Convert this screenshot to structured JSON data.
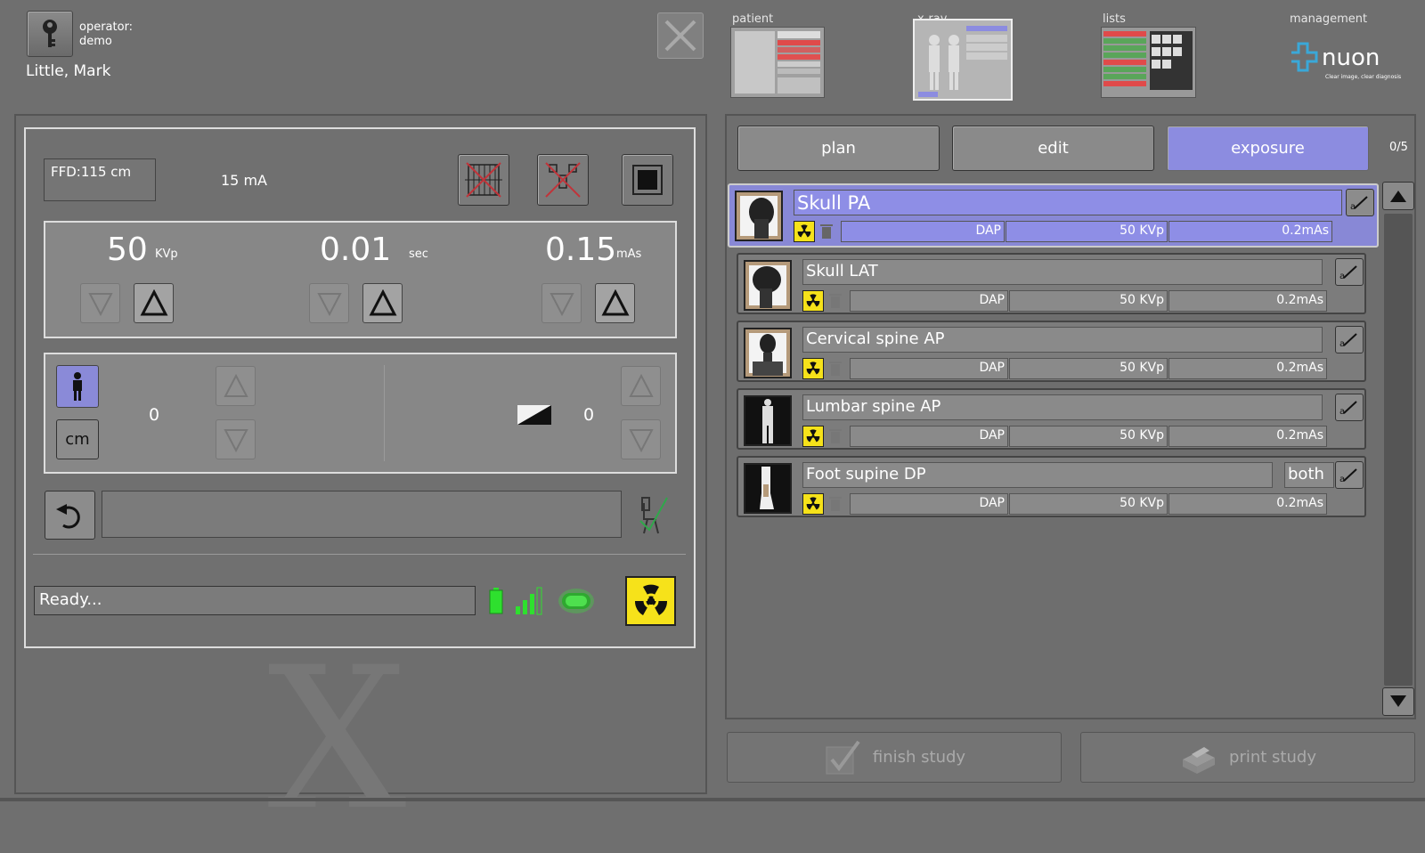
{
  "header": {
    "operator_label": "operator:",
    "operator_name": "demo",
    "patient_name": "Little,  Mark"
  },
  "nav": {
    "tabs": [
      {
        "label": "patient"
      },
      {
        "label": "x-ray"
      },
      {
        "label": "lists"
      },
      {
        "label": "management"
      }
    ],
    "active": "x-ray"
  },
  "brand": {
    "name": "nuon",
    "tagline": "Clear image, clear diagnosis",
    "color": "#3aa8d8"
  },
  "exposure_controls": {
    "ffd": "FFD:115 cm",
    "ma": "15 mA",
    "kvp": {
      "value": "50",
      "unit": "KVp"
    },
    "time": {
      "value": "0.01",
      "unit": "sec"
    },
    "mas": {
      "value": "0.15",
      "unit": "mAs"
    }
  },
  "patient_params": {
    "thickness_value": "0",
    "unit_button": "cm",
    "density_value": "0"
  },
  "status": {
    "text": "Ready..."
  },
  "workflow": {
    "buttons": [
      {
        "label": "plan"
      },
      {
        "label": "edit"
      },
      {
        "label": "exposure"
      }
    ],
    "active": "exposure",
    "counter": "0/5"
  },
  "exams": [
    {
      "title": "Skull PA",
      "dap": "DAP",
      "kvp": "50 KVp",
      "mas": "0.2mAs",
      "selected": true
    },
    {
      "title": "Skull LAT",
      "dap": "DAP",
      "kvp": "50 KVp",
      "mas": "0.2mAs"
    },
    {
      "title": "Cervical spine AP",
      "dap": "DAP",
      "kvp": "50 KVp",
      "mas": "0.2mAs"
    },
    {
      "title": "Lumbar spine AP",
      "dap": "DAP",
      "kvp": "50 KVp",
      "mas": "0.2mAs"
    },
    {
      "title": "Foot supine DP",
      "extra": "both",
      "dap": "DAP",
      "kvp": "50 KVp",
      "mas": "0.2mAs"
    }
  ],
  "footer": {
    "finish_label": "finish study",
    "print_label": "print study"
  },
  "colors": {
    "accent": "#8c8ce0",
    "radiation": "#f6e21a",
    "ready_led": "#3ddc3d"
  }
}
